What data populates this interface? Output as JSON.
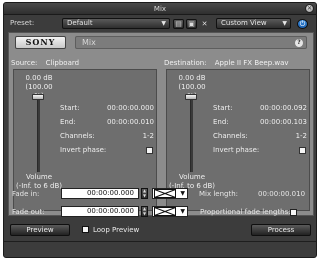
{
  "window": {
    "title": "Mix",
    "close_glyph": "✕"
  },
  "toolbar": {
    "preset_label": "Preset:",
    "preset_value": "Default",
    "view_value": "Custom View",
    "buttons": [
      {
        "icon": "save-preset-icon",
        "glyph": "▤"
      },
      {
        "icon": "disk-icon",
        "glyph": "▣"
      },
      {
        "icon": "delete-preset-icon",
        "glyph": "✕"
      }
    ],
    "power_glyph": "⏻"
  },
  "header": {
    "logo": "SONY",
    "effect_name": "Mix",
    "help_glyph": "?"
  },
  "source": {
    "caption": "Source:",
    "name": "Clipboard",
    "volume_db": "0.00 dB",
    "volume_pct": "(100.00 %)",
    "volume_level": 1.0,
    "slider_label_1": "Volume",
    "slider_label_2": "(-Inf. to 6 dB)",
    "start_label": "Start:",
    "start_value": "00:00:00.000",
    "end_label": "End:",
    "end_value": "00:00:00.010",
    "channels_label": "Channels:",
    "channels_value": "1-2",
    "invert_label": "Invert phase:"
  },
  "destination": {
    "caption": "Destination:",
    "name": "Apple II FX Beep.wav",
    "volume_db": "0.00 dB",
    "volume_pct": "(100.00 %)",
    "volume_level": 1.0,
    "slider_label_1": "Volume",
    "slider_label_2": "(-Inf. to 6 dB)",
    "start_label": "Start:",
    "start_value": "00:00:00.092",
    "end_label": "End:",
    "end_value": "00:00:00.103",
    "channels_label": "Channels:",
    "channels_value": "1-2",
    "invert_label": "Invert phase:"
  },
  "fades": {
    "fade_in_label": "Fade in:",
    "fade_in_value": "00:00:00.000",
    "fade_out_label": "Fade out:",
    "fade_out_value": "00:00:00.000",
    "mix_length_label": "Mix length:",
    "mix_length_value": "00:00:00.010",
    "proportional_label": "Proportional fade lengths:"
  },
  "footer": {
    "preview_label": "Preview",
    "loop_preview_label": "Loop Preview",
    "process_label": "Process"
  }
}
